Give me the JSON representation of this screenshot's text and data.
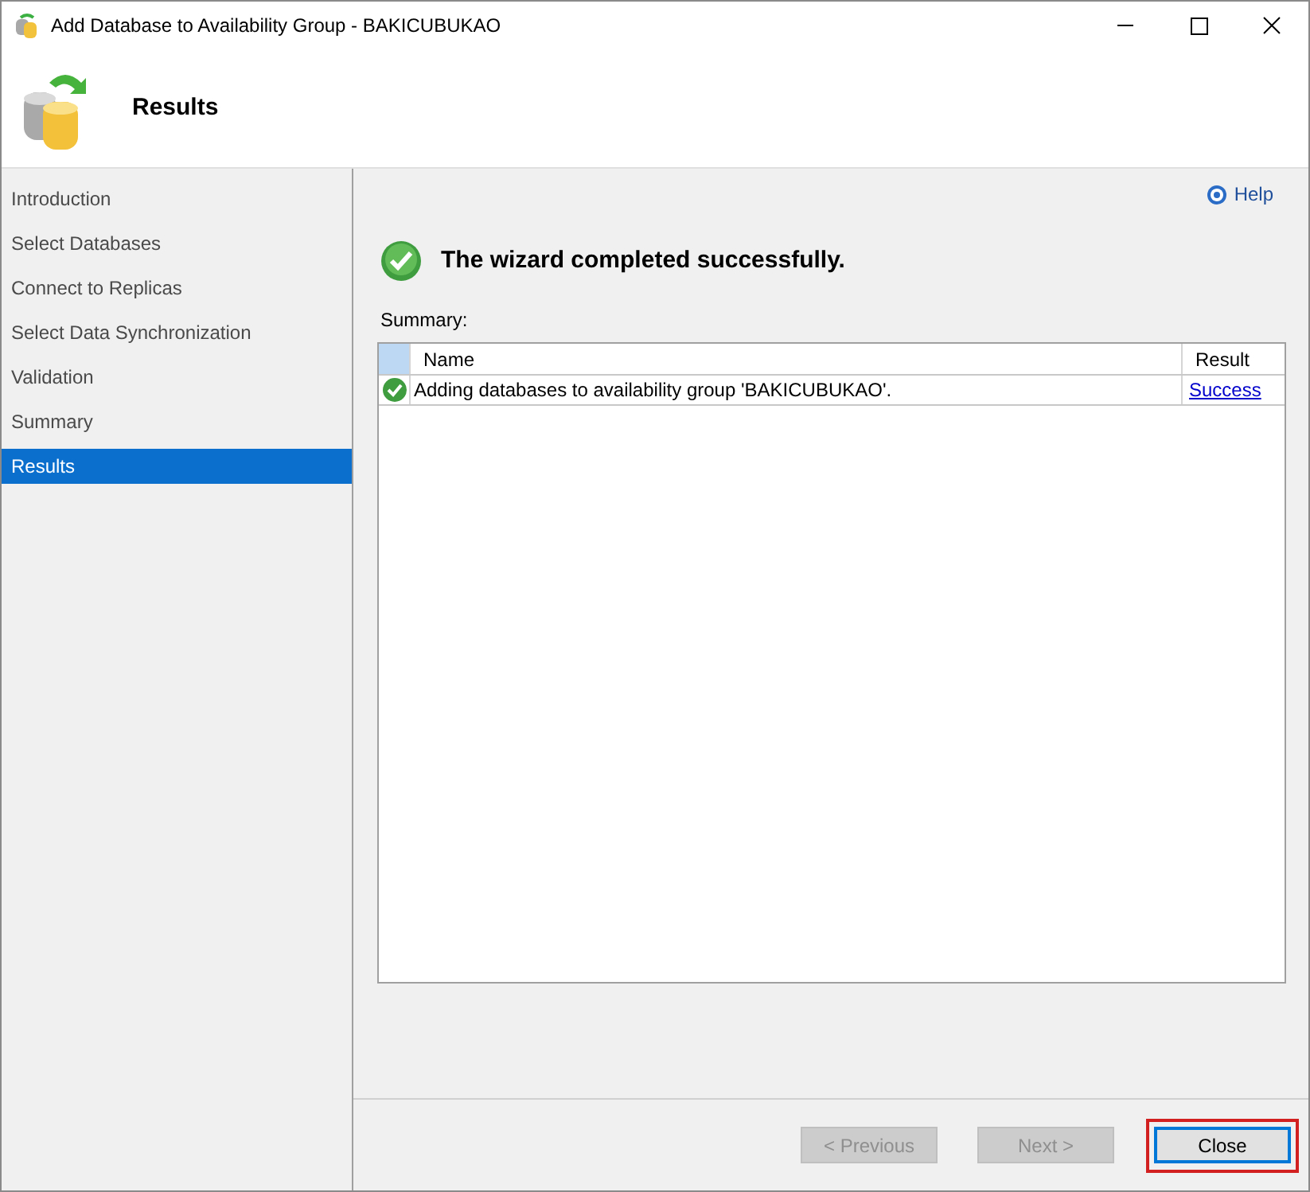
{
  "window": {
    "title": "Add Database to Availability Group - BAKICUBUKAO"
  },
  "header": {
    "title": "Results"
  },
  "steps": [
    {
      "label": "Introduction",
      "selected": false
    },
    {
      "label": "Select Databases",
      "selected": false
    },
    {
      "label": "Connect to Replicas",
      "selected": false
    },
    {
      "label": "Select Data Synchronization",
      "selected": false
    },
    {
      "label": "Validation",
      "selected": false
    },
    {
      "label": "Summary",
      "selected": false
    },
    {
      "label": "Results",
      "selected": true
    }
  ],
  "help": {
    "label": "Help"
  },
  "status_message": "The wizard completed successfully.",
  "summary": {
    "label": "Summary:",
    "columns": [
      "Name",
      "Result"
    ],
    "rows": [
      {
        "kind": "success",
        "name": "Adding databases to availability group 'BAKICUBUKAO'.",
        "result": "Success"
      }
    ]
  },
  "buttons": [
    {
      "label": "< Previous",
      "disabled": true,
      "default": false,
      "highlighted": false
    },
    {
      "label": "Next >",
      "disabled": true,
      "default": false,
      "highlighted": false
    },
    {
      "label": "Close",
      "disabled": false,
      "default": true,
      "highlighted": true
    }
  ]
}
